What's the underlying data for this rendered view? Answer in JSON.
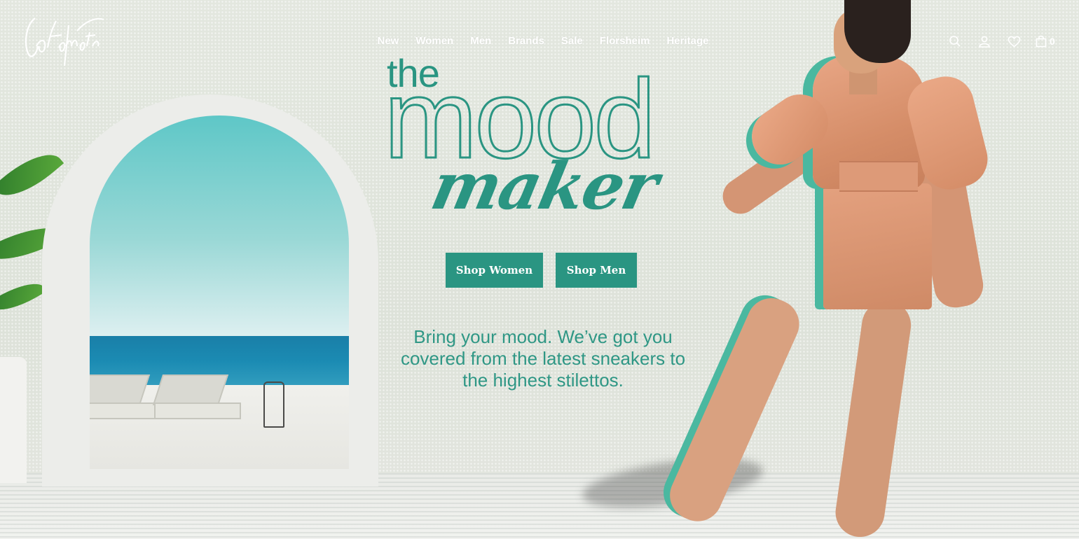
{
  "brand": {
    "logo_name": "Cotton Cotto",
    "logo_text": "Cotovoito"
  },
  "nav": {
    "items": [
      "New",
      "Women",
      "Men",
      "Brands",
      "Sale",
      "Florsheim",
      "Heritage"
    ]
  },
  "header_icons": {
    "search": "search-icon",
    "account": "user-icon",
    "wishlist": "heart-icon",
    "cart": "bag-icon",
    "cart_count": "0"
  },
  "hero": {
    "headline_the": "the",
    "headline_mood": "mood",
    "headline_maker": "maker",
    "buttons": {
      "shop_women": "Shop Women",
      "shop_men": "Shop Men"
    },
    "tagline": "Bring your mood. We’ve got you covered from the latest sneakers to the highest stilettos."
  },
  "colors": {
    "accent": "#2a9582",
    "background": "#dfe3dc",
    "nav_text": "#ffffff"
  }
}
